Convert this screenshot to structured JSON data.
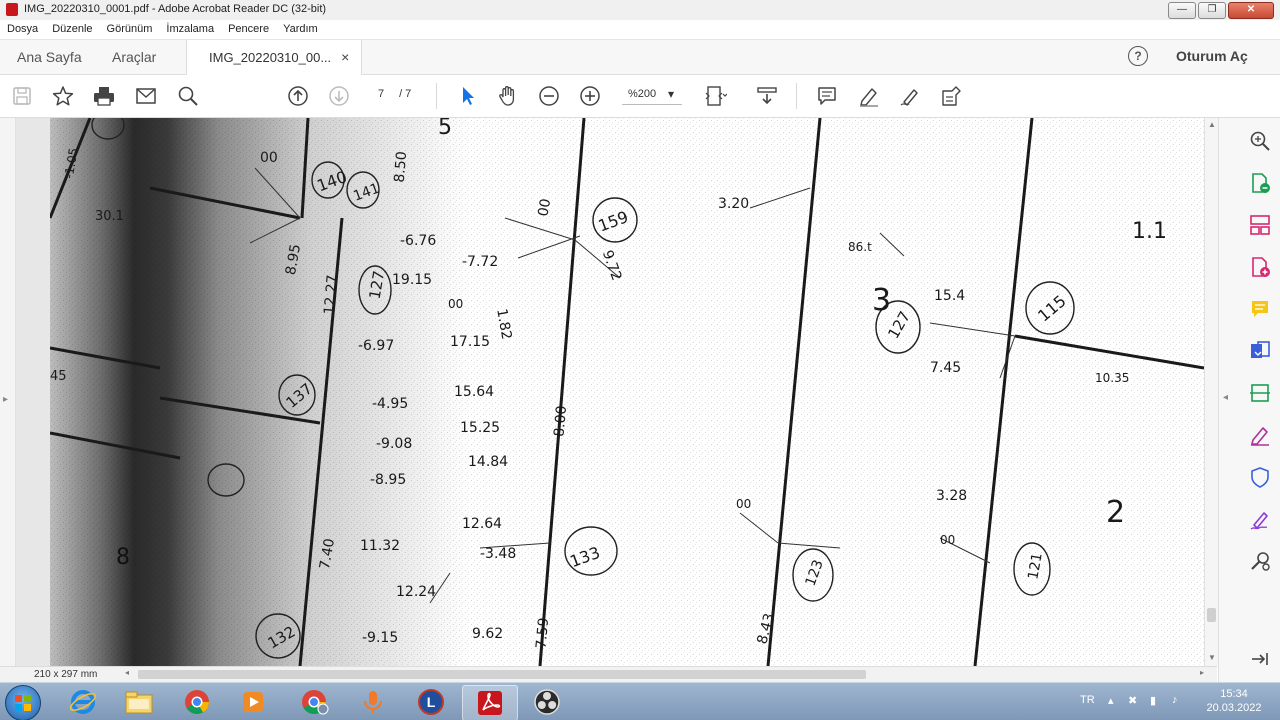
{
  "window": {
    "title": "IMG_20220310_0001.pdf - Adobe Acrobat Reader DC (32-bit)",
    "minimize": "—",
    "maximize": "❐",
    "close": "✕"
  },
  "menu": [
    "Dosya",
    "Düzenle",
    "Görünüm",
    "İmzalama",
    "Pencere",
    "Yardım"
  ],
  "tabs": {
    "home": "Ana Sayfa",
    "tools": "Araçlar",
    "document": "IMG_20220310_00...",
    "close": "×"
  },
  "header": {
    "help": "?",
    "signin": "Oturum Aç"
  },
  "toolbar": {
    "page_current": "7",
    "page_total": "/ 7",
    "zoom": "%200",
    "zoom_arrow": "▾"
  },
  "status": {
    "page_size": "210 x 297 mm"
  },
  "document": {
    "labels": [
      "5",
      "3.20",
      "00",
      "159",
      "9.72",
      "00",
      "8.50",
      "141",
      "140",
      "-6.76",
      "8.95",
      "19.15",
      "-7.72",
      "127",
      "12.27",
      "00",
      "1.82",
      "-6.97",
      "17.15",
      "30.1",
      "-1.05",
      "3",
      "15.4",
      "86.t",
      "127",
      "115",
      "7.45",
      "10.35",
      "45",
      "137",
      "-4.95",
      "15.64",
      "-9.08",
      "15.25",
      "-8.95",
      "14.84",
      "8.00",
      "3.28",
      "2",
      "00",
      "11.32",
      "12.64",
      "-3.48",
      "133",
      "00",
      "123",
      "121",
      "12.24",
      "7.40",
      "-9.15",
      "9.62",
      "132",
      "7.59",
      "8.43",
      "8",
      "1.1"
    ]
  },
  "taskbar": {
    "lang": "TR",
    "time": "15:34",
    "date": "20.03.2022"
  }
}
